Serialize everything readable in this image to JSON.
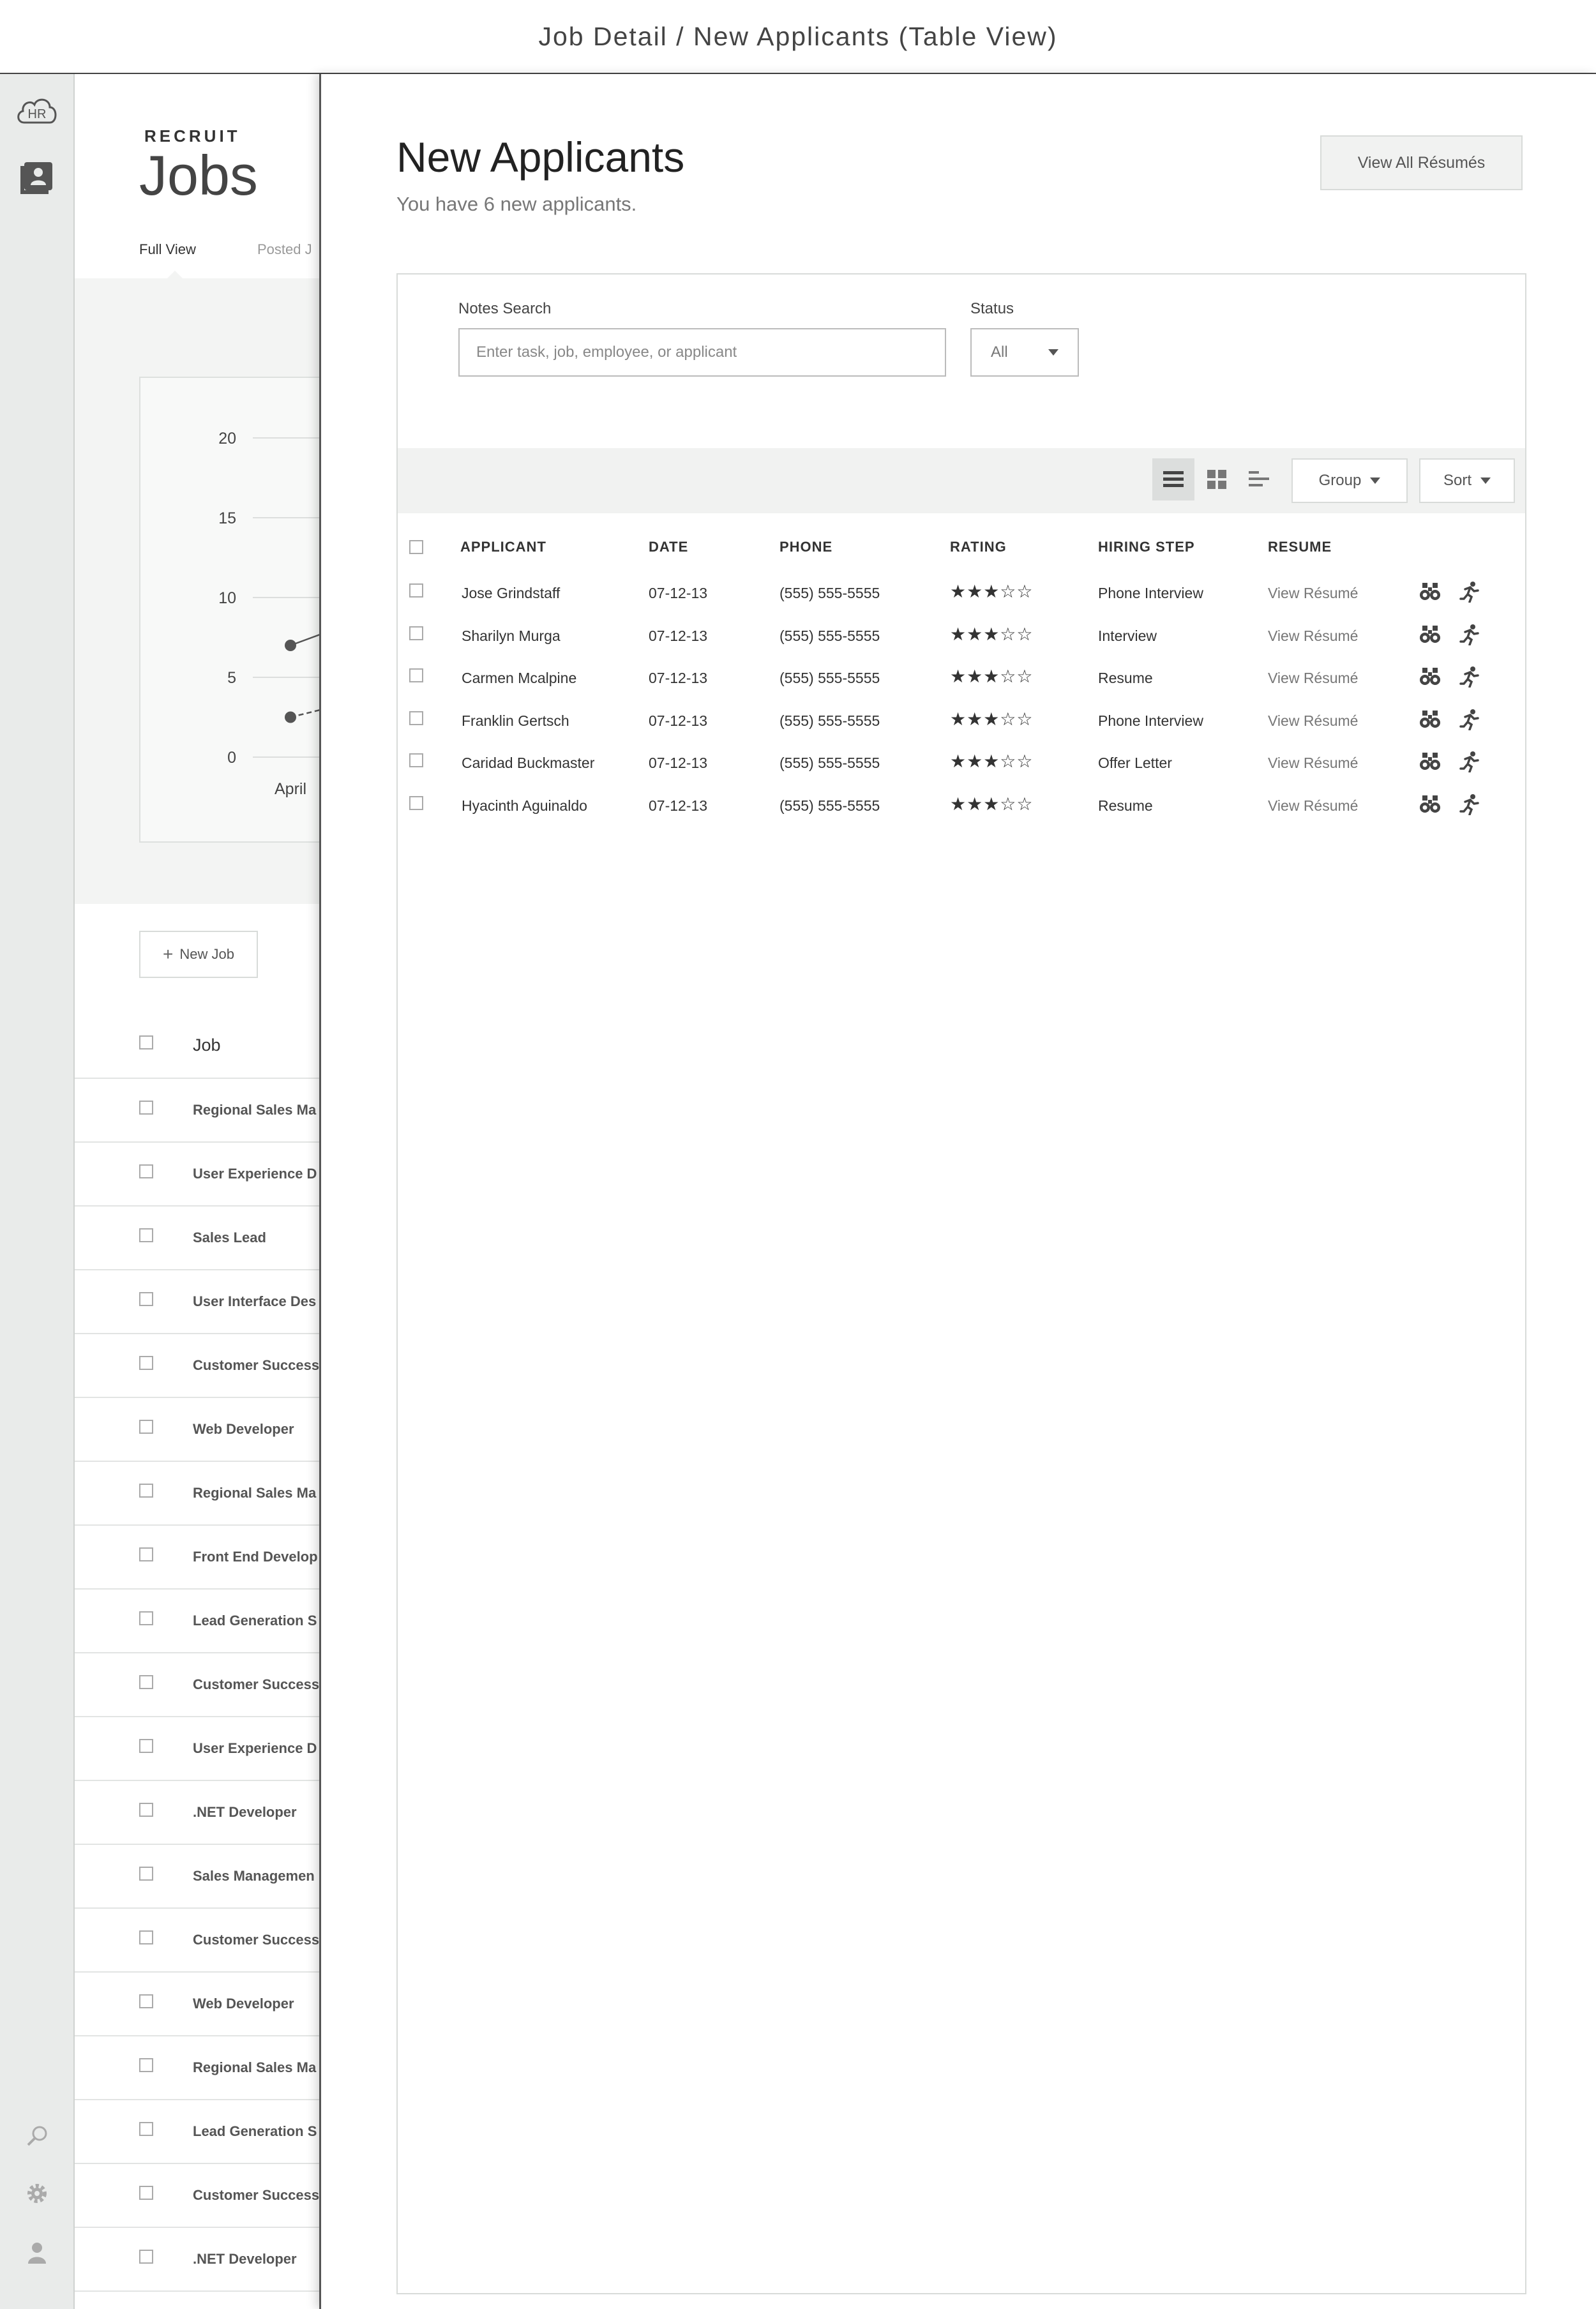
{
  "topbar": {
    "title": "Job Detail / New Applicants (Table View)"
  },
  "rail": {
    "logo_text": "HR",
    "icons": [
      "hr-cloud-icon",
      "applicants-icon",
      "search-icon",
      "gear-icon",
      "user-icon"
    ]
  },
  "jobs_page": {
    "eyebrow": "RECRUIT",
    "title": "Jobs",
    "tabs": [
      "Full View",
      "Posted J"
    ],
    "chart_data": {
      "type": "line",
      "y_ticks": [
        "20",
        "15",
        "10",
        "5",
        "0"
      ],
      "ylim": [
        0,
        20
      ],
      "x_ticks": [
        "April"
      ],
      "series": [
        {
          "values": [
            7
          ]
        },
        {
          "values": [
            2.5
          ]
        }
      ]
    },
    "new_job_label": "New Job",
    "job_column_header": "Job",
    "jobs": [
      "Regional Sales Ma",
      "User Experience D",
      "Sales Lead",
      "User Interface Des",
      "Customer Success",
      "Web Developer",
      "Regional Sales Ma",
      "Front End Develop",
      "Lead Generation S",
      "Customer Success",
      "User Experience D",
      ".NET Developer",
      "Sales Managemen",
      "Customer Success",
      "Web Developer",
      "Regional Sales Ma",
      "Lead Generation S",
      "Customer Success",
      ".NET Developer"
    ]
  },
  "panel": {
    "title": "New Applicants",
    "subtitle": "You have 6 new applicants.",
    "view_all_label": "View All Résumés",
    "filters": {
      "notes_label": "Notes Search",
      "notes_placeholder": "Enter task, job, employee, or applicant",
      "status_label": "Status",
      "status_value": "All"
    },
    "toolbar": {
      "views": [
        "list-view-icon",
        "grid-view-icon",
        "timeline-view-icon"
      ],
      "active_view": "list-view-icon",
      "group_label": "Group",
      "sort_label": "Sort"
    },
    "columns": [
      "APPLICANT",
      "DATE",
      "PHONE",
      "RATING",
      "HIRING STEP",
      "RESUME"
    ],
    "applicants": [
      {
        "name": "Jose Grindstaff",
        "date": "07-12-13",
        "phone": "(555) 555-5555",
        "rating": 3,
        "stars": "★★★☆☆",
        "step": "Phone Interview",
        "resume": "View Résumé"
      },
      {
        "name": "Sharilyn Murga",
        "date": "07-12-13",
        "phone": "(555) 555-5555",
        "rating": 3,
        "stars": "★★★☆☆",
        "step": "Interview",
        "resume": "View Résumé"
      },
      {
        "name": "Carmen Mcalpine",
        "date": "07-12-13",
        "phone": "(555) 555-5555",
        "rating": 3,
        "stars": "★★★☆☆",
        "step": "Resume",
        "resume": "View Résumé"
      },
      {
        "name": "Franklin Gertsch",
        "date": "07-12-13",
        "phone": "(555) 555-5555",
        "rating": 3,
        "stars": "★★★☆☆",
        "step": "Phone Interview",
        "resume": "View Résumé"
      },
      {
        "name": "Caridad Buckmaster",
        "date": "07-12-13",
        "phone": "(555) 555-5555",
        "rating": 3,
        "stars": "★★★☆☆",
        "step": "Offer Letter",
        "resume": "View Résumé"
      },
      {
        "name": "Hyacinth Aguinaldo",
        "date": "07-12-13",
        "phone": "(555) 555-5555",
        "rating": 3,
        "stars": "★★★☆☆",
        "step": "Resume",
        "resume": "View Résumé"
      }
    ],
    "row_actions": [
      "binoculars-icon",
      "running-person-icon"
    ]
  }
}
